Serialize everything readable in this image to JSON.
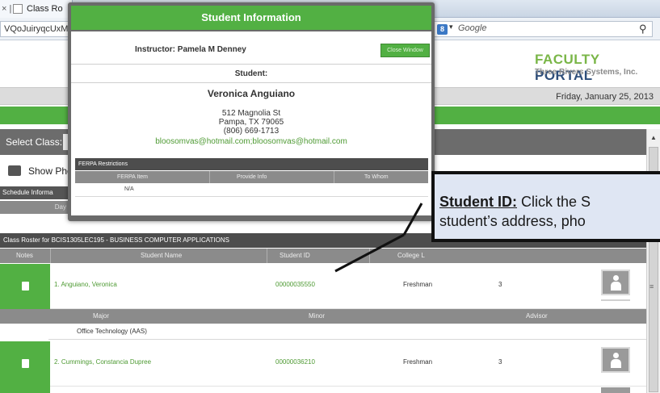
{
  "browser": {
    "tab_title": "Class Ro",
    "url_fragment": "VQoJuiryqcUxMI",
    "search_engine": "Google"
  },
  "portal": {
    "brand_word1": "FACULTY",
    "brand_word2": "PORTAL",
    "company": "Three Rivers Systems, Inc.",
    "date": "Friday, January 25, 2013"
  },
  "page": {
    "select_class_label": "Select Class:",
    "show_photos_label": "Show Pho",
    "schedule_label": "Schedule Informa",
    "day_label": "Day"
  },
  "modal": {
    "title": "Student Information",
    "instructor": "Instructor: Pamela M Denney",
    "close_button": "Close Window",
    "student_label": "Student:",
    "student_name": "Veronica Anguiano",
    "address_line1": "512 Magnolia St",
    "address_line2": "Pampa, TX 79065",
    "phone": "(806) 669-1713",
    "email": "bloosomvas@hotmail.com;bloosomvas@hotmail.com",
    "ferpa_title": "FERPA Restrictions",
    "ferpa_columns": [
      "FERPA Item",
      "Provide Info",
      "To Whom"
    ],
    "ferpa_value": "N/A"
  },
  "roster": {
    "title": "Class Roster for BCIS1305LEC195 - BUSINESS COMPUTER APPLICATIONS",
    "columns": [
      "Notes",
      "Student Name",
      "Student ID",
      "College L"
    ],
    "rows": [
      {
        "name": "1. Anguiano, Veronica",
        "student_id": "00000035550",
        "level": "Freshman",
        "credits": "3"
      },
      {
        "name": "2. Cummings, Constancia Dupree",
        "student_id": "00000036210",
        "level": "Freshman",
        "credits": "3"
      }
    ],
    "major_columns": [
      "Major",
      "Minor",
      "Advisor"
    ],
    "major_value": "Office Technology (AAS)"
  },
  "callout": {
    "label": "Student ID:",
    "line1_rest": " Click the S",
    "line2": "student’s address, pho"
  },
  "colors": {
    "accent_green": "#52b043",
    "dark_gray": "#4d4d4d",
    "callout_bg": "#dfe6f3"
  }
}
